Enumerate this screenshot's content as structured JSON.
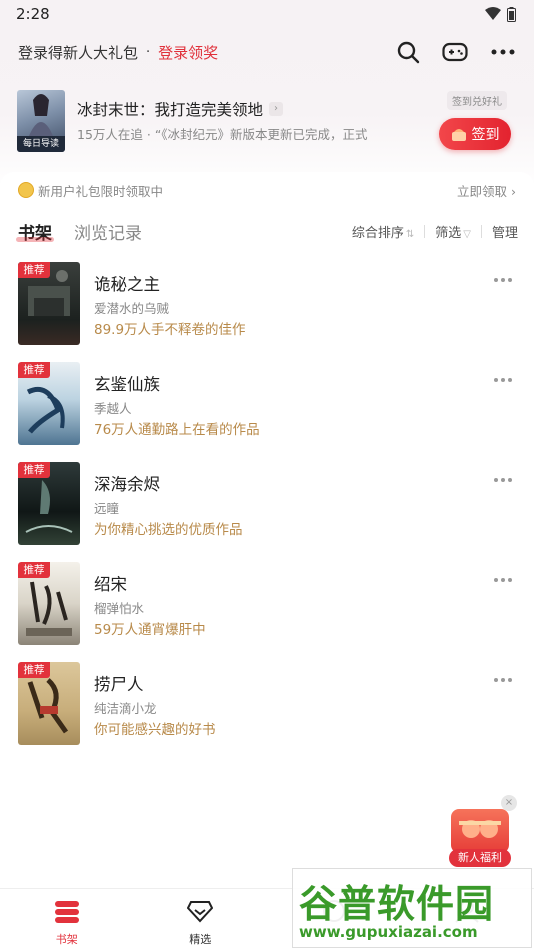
{
  "status": {
    "time": "2:28"
  },
  "header": {
    "login_text": "登录得新人大礼包",
    "dot": "·",
    "login_link": "登录领奖",
    "icons": [
      "search-icon",
      "gamepad-icon",
      "more-icon"
    ]
  },
  "banner": {
    "cover_tag": "每日导读",
    "title": "冰封末世：我打造完美领地",
    "subtitle": "15万人在追 · “《冰封纪元》新版本更新已完成，正式",
    "gift_label": "签到兑好礼",
    "sign_label": "签到"
  },
  "promo": {
    "text": "新用户礼包限时领取中",
    "action": "立即领取"
  },
  "tabs": {
    "shelf": "书架",
    "history": "浏览记录",
    "sort": "综合排序",
    "filter": "筛选",
    "manage": "管理"
  },
  "books": [
    {
      "badge": "推荐",
      "title": "诡秘之主",
      "author": "爱潜水的乌贼",
      "desc": "89.9万人手不释卷的佳作"
    },
    {
      "badge": "推荐",
      "title": "玄鉴仙族",
      "author": "季越人",
      "desc": "76万人通勤路上在看的作品"
    },
    {
      "badge": "推荐",
      "title": "深海余烬",
      "author": "远瞳",
      "desc": "为你精心挑选的优质作品"
    },
    {
      "badge": "推荐",
      "title": "绍宋",
      "author": "榴弹怕水",
      "desc": "59万人通宵爆肝中"
    },
    {
      "badge": "推荐",
      "title": "捞尸人",
      "author": "纯洁滴小龙",
      "desc": "你可能感兴趣的好书"
    }
  ],
  "float_gift": {
    "label": "新人福利",
    "close": "×"
  },
  "bottom_nav": [
    {
      "label": "书架",
      "icon": "bookshelf-icon"
    },
    {
      "label": "精选",
      "icon": "diamond-icon"
    },
    {
      "label": "",
      "icon": "category-icon"
    },
    {
      "label": "",
      "icon": "user-icon"
    }
  ],
  "watermark": {
    "text": "谷普软件园",
    "url": "www.gupuxiazai.com"
  },
  "colors": {
    "accent": "#e2323c",
    "desc_gold": "#b88a4a",
    "muted": "#888888"
  }
}
